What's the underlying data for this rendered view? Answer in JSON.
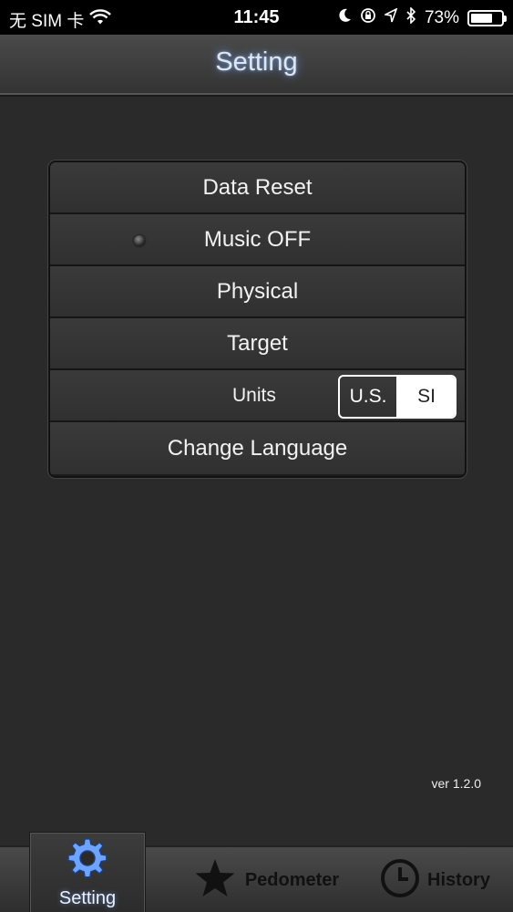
{
  "status_bar": {
    "carrier": "无 SIM 卡",
    "time": "11:45",
    "battery": "73%",
    "battery_level": 0.73
  },
  "nav": {
    "title": "Setting"
  },
  "settings": {
    "data_reset": "Data Reset",
    "music": "Music OFF",
    "physical": "Physical",
    "target": "Target",
    "units_label": "Units",
    "units_us": "U.S.",
    "units_si": "SI",
    "units_selected": "SI",
    "change_language": "Change Language"
  },
  "version": "ver 1.2.0",
  "tabs": {
    "setting": "Setting",
    "pedometer": "Pedometer",
    "history": "History",
    "active": "Setting"
  },
  "icons": [
    "wifi-icon",
    "moon-icon",
    "rotation-lock-icon",
    "location-icon",
    "bluetooth-icon",
    "battery-icon",
    "gear-icon",
    "star-icon",
    "clock-icon"
  ]
}
